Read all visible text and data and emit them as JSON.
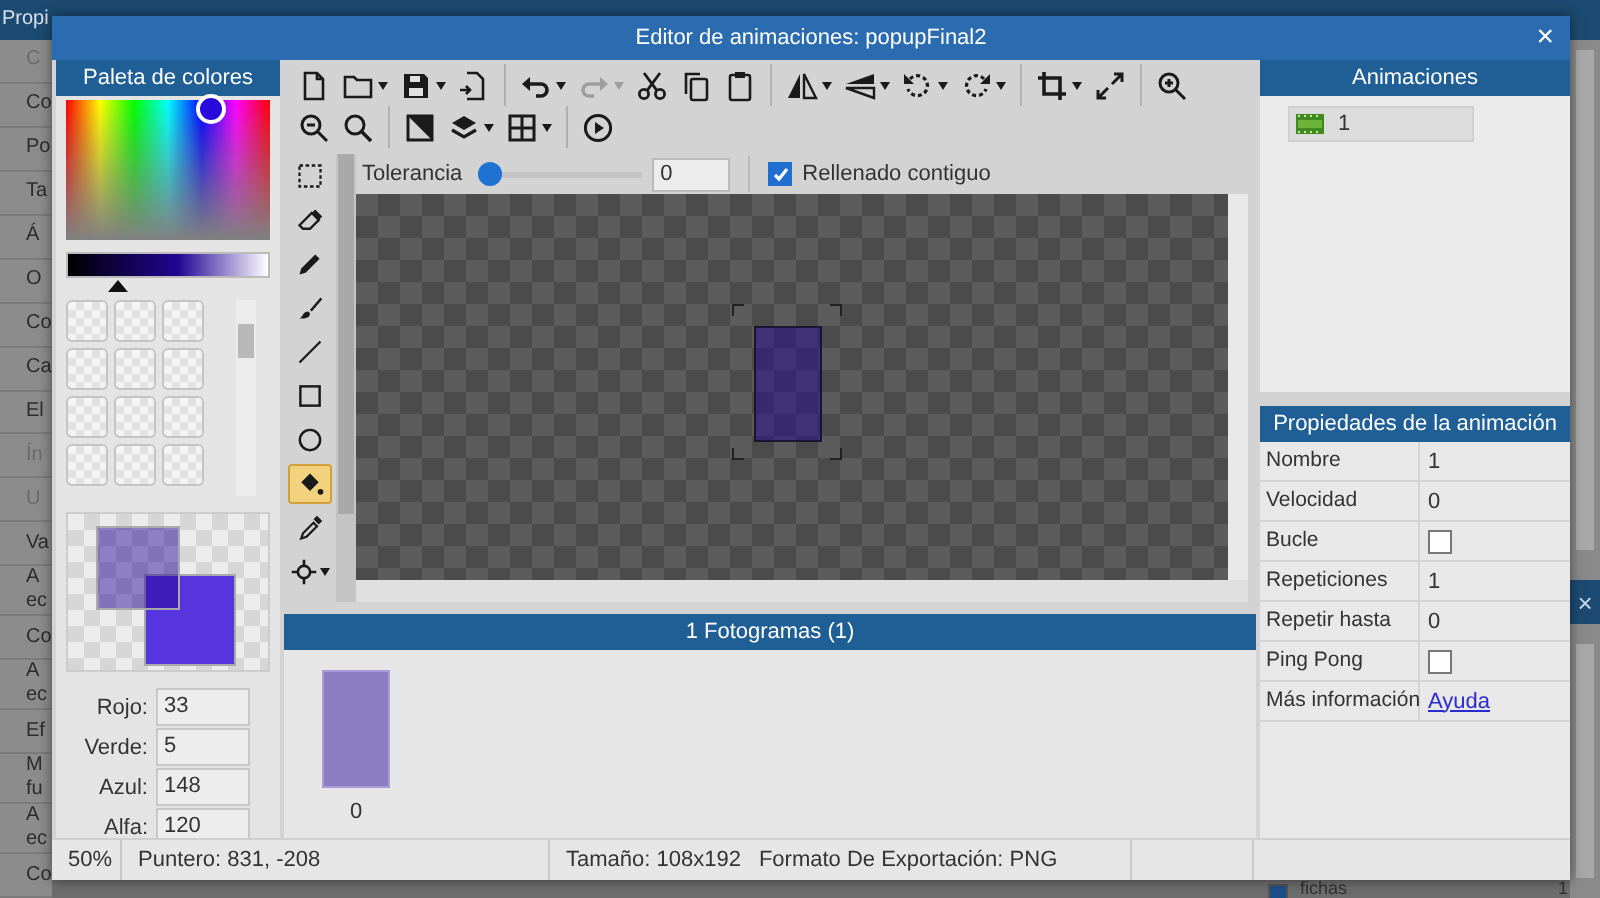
{
  "background": {
    "panel_title": "Propi",
    "items": [
      {
        "label": "C",
        "disabled": true
      },
      {
        "label": "Co",
        "disabled": false
      },
      {
        "label": "Po",
        "disabled": false
      },
      {
        "label": "Ta",
        "disabled": false
      },
      {
        "label": "Á",
        "disabled": false
      },
      {
        "label": "O",
        "disabled": false
      },
      {
        "label": "Co",
        "disabled": false
      },
      {
        "label": "Ca",
        "disabled": false
      },
      {
        "label": "El",
        "disabled": false
      },
      {
        "label": "Ín",
        "disabled": true
      },
      {
        "label": "U",
        "disabled": true
      },
      {
        "label": "Va",
        "disabled": false
      },
      {
        "label": "A ec",
        "disabled": false
      },
      {
        "label": "Co",
        "disabled": false
      },
      {
        "label": "A ec",
        "disabled": false
      },
      {
        "label": "Ef",
        "disabled": false
      },
      {
        "label": "M fu",
        "disabled": false
      },
      {
        "label": "A ec",
        "disabled": false
      },
      {
        "label": "Co",
        "disabled": false
      }
    ],
    "close_glyph": "×",
    "bottom_row": {
      "checked": true,
      "label": "fichas",
      "value": "1"
    }
  },
  "window": {
    "title": "Editor de animaciones: popupFinal2",
    "close_glyph": "×"
  },
  "palette": {
    "title": "Paleta de colores",
    "channels": [
      {
        "label": "Rojo:",
        "value": "33"
      },
      {
        "label": "Verde:",
        "value": "5"
      },
      {
        "label": "Azul:",
        "value": "148"
      },
      {
        "label": "Alfa:",
        "value": "120"
      }
    ]
  },
  "toolbar": [
    {
      "kind": "new",
      "menu": false,
      "disabled": false,
      "separator_before": false
    },
    {
      "kind": "open",
      "menu": true,
      "disabled": false,
      "separator_before": false
    },
    {
      "kind": "save",
      "menu": true,
      "disabled": false,
      "separator_before": false
    },
    {
      "kind": "export",
      "menu": false,
      "disabled": false,
      "separator_before": false
    },
    {
      "kind": "undo",
      "menu": true,
      "disabled": false,
      "separator_before": true
    },
    {
      "kind": "redo",
      "menu": true,
      "disabled": true,
      "separator_before": false
    },
    {
      "kind": "cut",
      "menu": false,
      "disabled": false,
      "separator_before": false
    },
    {
      "kind": "copy",
      "menu": false,
      "disabled": false,
      "separator_before": false
    },
    {
      "kind": "paste",
      "menu": false,
      "disabled": false,
      "separator_before": false
    },
    {
      "kind": "flip-h",
      "menu": true,
      "disabled": false,
      "separator_before": true
    },
    {
      "kind": "flip-v",
      "menu": true,
      "disabled": false,
      "separator_before": false
    },
    {
      "kind": "rotate-left",
      "menu": true,
      "disabled": false,
      "separator_before": false
    },
    {
      "kind": "rotate-right",
      "menu": true,
      "disabled": false,
      "separator_before": false
    },
    {
      "kind": "crop",
      "menu": true,
      "disabled": false,
      "separator_before": true
    },
    {
      "kind": "resize",
      "menu": false,
      "disabled": false,
      "separator_before": false
    },
    {
      "kind": "zoom-in",
      "menu": false,
      "disabled": false,
      "separator_before": true
    },
    {
      "kind": "zoom-out",
      "menu": false,
      "disabled": false,
      "separator_before": false
    },
    {
      "kind": "zoom-fit",
      "menu": false,
      "disabled": false,
      "separator_before": false
    },
    {
      "kind": "mask",
      "menu": false,
      "disabled": false,
      "separator_before": true
    },
    {
      "kind": "layers",
      "menu": true,
      "disabled": false,
      "separator_before": false
    },
    {
      "kind": "grid",
      "menu": true,
      "disabled": false,
      "separator_before": false
    },
    {
      "kind": "play",
      "menu": false,
      "disabled": false,
      "separator_before": true
    }
  ],
  "tools": [
    {
      "kind": "select",
      "selected": false,
      "menu": false
    },
    {
      "kind": "eraser",
      "selected": false,
      "menu": false
    },
    {
      "kind": "pencil",
      "selected": false,
      "menu": false
    },
    {
      "kind": "brush",
      "selected": false,
      "menu": false
    },
    {
      "kind": "line",
      "selected": false,
      "menu": false
    },
    {
      "kind": "rect",
      "selected": false,
      "menu": false
    },
    {
      "kind": "ellipse",
      "selected": false,
      "menu": false
    },
    {
      "kind": "fill",
      "selected": true,
      "menu": false
    },
    {
      "kind": "picker",
      "selected": false,
      "menu": false
    },
    {
      "kind": "pivot",
      "selected": false,
      "menu": true
    }
  ],
  "tool_options": {
    "tolerance_label": "Tolerancia",
    "tolerance": {
      "level": 0
    },
    "tolerance_value": "0",
    "contiguous_label": "Rellenado contiguo",
    "contiguous_checked": true
  },
  "frames": {
    "title": "1 Fotogramas (1)",
    "items": [
      {
        "label": "0"
      }
    ]
  },
  "animations": {
    "title": "Animaciones",
    "items": [
      {
        "label": "1",
        "selected": true
      }
    ]
  },
  "properties": {
    "title": "Propiedades de la animación",
    "rows": [
      {
        "kind": "text",
        "label": "Nombre",
        "value": "1"
      },
      {
        "kind": "text",
        "label": "Velocidad",
        "value": "0"
      },
      {
        "kind": "checkbox",
        "label": "Bucle",
        "checked": false
      },
      {
        "kind": "text",
        "label": "Repeticiones",
        "value": "1"
      },
      {
        "kind": "text",
        "label": "Repetir hasta",
        "value": "0"
      },
      {
        "kind": "checkbox",
        "label": "Ping Pong",
        "checked": false
      },
      {
        "kind": "link",
        "label": "Más información",
        "value": "Ayuda"
      }
    ]
  },
  "status_bar": {
    "zoom": "50%",
    "pointer": "Puntero: 831, -208",
    "size": "Tamaño: 108x192",
    "format": "Formato De Exportación: PNG"
  }
}
